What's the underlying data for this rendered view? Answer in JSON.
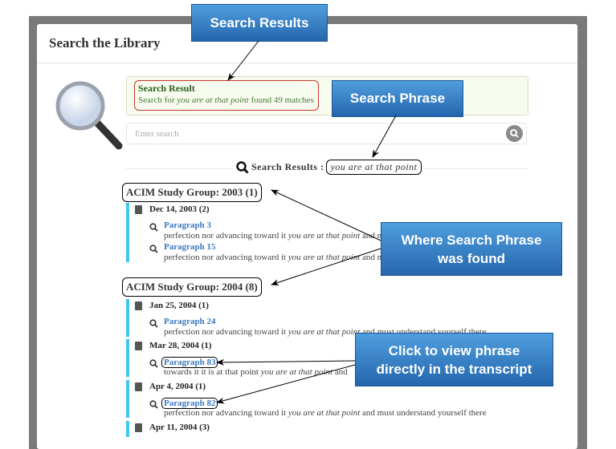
{
  "page": {
    "title": "Search the Library"
  },
  "alert": {
    "title": "Search Result",
    "msg_prefix": "Search for ",
    "msg_phrase": "you are at that point",
    "msg_suffix": " found 49 matches"
  },
  "search": {
    "placeholder": "Enter search",
    "value": ""
  },
  "results": {
    "heading": "Search Results :",
    "phrase": "you are at that point"
  },
  "groups": [
    {
      "label": "ACIM Study Group: 2003 (1)",
      "dates": [
        {
          "label": "Dec 14, 2003 (2)",
          "items": [
            {
              "link": "Paragraph 3",
              "pre": "perfection nor advancing toward it ",
              "hit": "you are at that point",
              "post": " and must understand yourself there"
            },
            {
              "link": "Paragraph 15",
              "pre": "perfection nor advancing toward it ",
              "hit": "you are at that point",
              "post": " and must understand yourself there"
            }
          ]
        }
      ]
    },
    {
      "label": "ACIM Study Group: 2004 (8)",
      "dates": [
        {
          "label": "Jan 25, 2004 (1)",
          "items": [
            {
              "link": "Paragraph 24",
              "pre": "perfection nor advancing toward it ",
              "hit": "you are at that point",
              "post": " and must understand yourself there"
            }
          ]
        },
        {
          "label": "Mar 28, 2004 (1)",
          "items": [
            {
              "link": "Paragraph 83",
              "pre": "towards it it is at that point ",
              "hit": "you are at that point",
              "post": " and"
            }
          ]
        },
        {
          "label": "Apr 4, 2004 (1)",
          "items": [
            {
              "link": "Paragraph 82",
              "pre": "perfection nor advancing toward it ",
              "hit": "you are at that point",
              "post": " and must understand yourself there"
            }
          ]
        },
        {
          "label": "Apr 11, 2004 (3)",
          "items": []
        }
      ]
    }
  ],
  "annotations": {
    "search_results": "Search Results",
    "search_phrase": "Search Phrase",
    "where_found": "Where Search Phrase was found",
    "click_view": "Click to view phrase directly in the transcript"
  },
  "colors": {
    "accent_bar": "#3ec6f0",
    "link": "#3a78c2",
    "callout": "#2f78c4"
  }
}
